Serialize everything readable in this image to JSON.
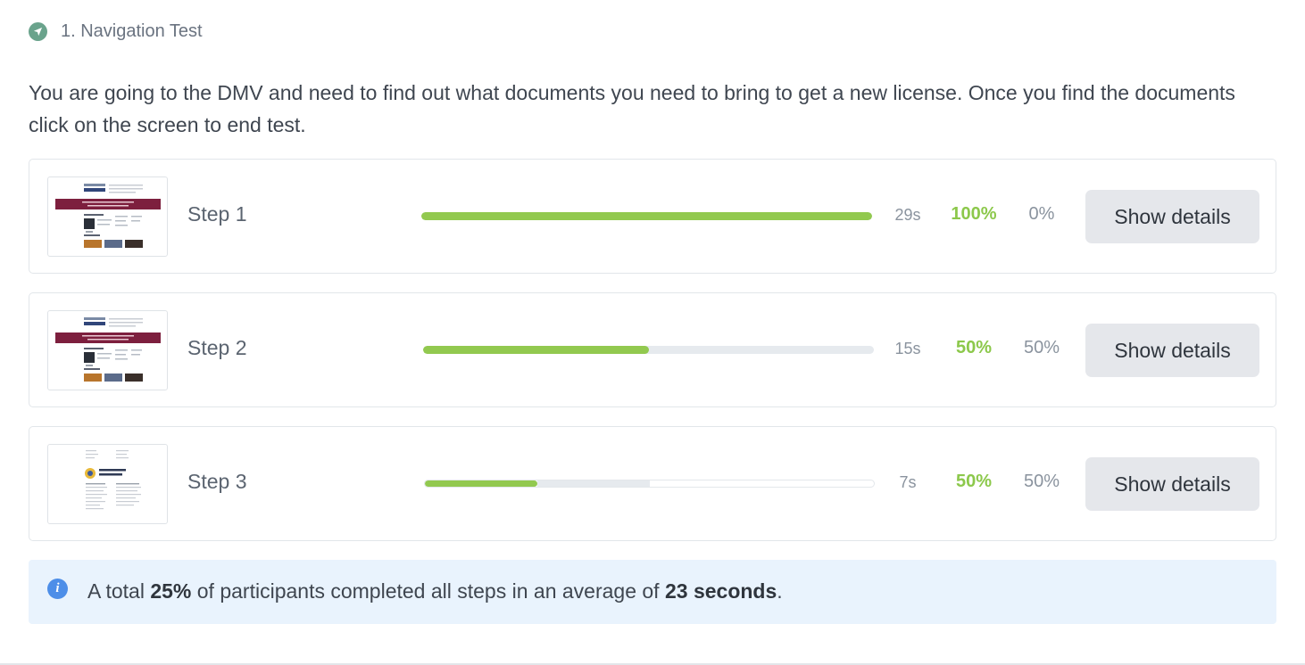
{
  "test": {
    "icon": "navigation-arrow-icon",
    "title": "1. Navigation Test",
    "instructions": "You are going to the DMV and need to find out what documents you need to bring to get a new license. Once you find the documents click on the screen to end test."
  },
  "steps": [
    {
      "label": "Step 1",
      "time": "29s",
      "success_pct": "100%",
      "fail_pct": "0%",
      "success_fraction": 1.0,
      "button_label": "Show details",
      "thumbnail": "dmv-homepage-thumbnail"
    },
    {
      "label": "Step 2",
      "time": "15s",
      "success_pct": "50%",
      "fail_pct": "50%",
      "success_fraction": 0.5,
      "button_label": "Show details",
      "thumbnail": "dmv-homepage-thumbnail"
    },
    {
      "label": "Step 3",
      "time": "7s",
      "success_pct": "50%",
      "fail_pct": "50%",
      "success_fraction": 0.25,
      "gray_fraction": 0.25,
      "button_label": "Show details",
      "thumbnail": "social-security-verification-thumbnail"
    }
  ],
  "summary": {
    "icon": "info-icon",
    "prefix": "A total ",
    "pct": "25%",
    "middle": " of participants completed all steps in an average of ",
    "time": "23 seconds",
    "suffix": "."
  },
  "colors": {
    "accent_green": "#92c94f",
    "success_text": "#8cc84b",
    "info_blue": "#4d8ee8",
    "summary_bg": "#e9f3fd",
    "nav_icon_green": "#6aa38c"
  }
}
